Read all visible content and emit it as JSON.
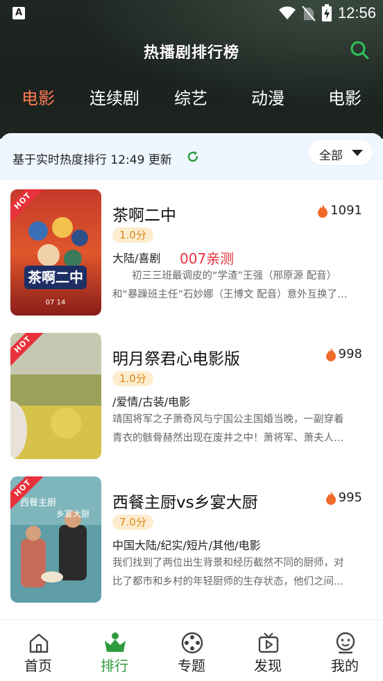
{
  "status": {
    "time": "12:56",
    "a_badge": "A"
  },
  "header": {
    "title": "热播剧排行榜"
  },
  "tabs": [
    "电影",
    "连续剧",
    "综艺",
    "动漫",
    "电影"
  ],
  "info": {
    "text": "基于实时热度排行 12:49 更新",
    "filter_label": "全部"
  },
  "items": [
    {
      "badge": "HOT",
      "title": "茶啊二中",
      "heat": "1091",
      "score": "1.0分",
      "genre": "大陆/喜剧",
      "tag": "007亲测",
      "desc1": "初三三班最调皮的“学渣”王强（邢原源 配音）",
      "desc2": "和“暴躁班主任”石妙娜（王博文 配音）意外互换了…"
    },
    {
      "badge": "HOT",
      "title": "明月祭君心电影版",
      "heat": "998",
      "score": "1.0分",
      "genre": "/爱情/古装/电影",
      "desc1": "靖国将军之子萧奇风与宁国公主国婚当晚，一副穿着",
      "desc2": "青衣的骸骨赫然出现在废井之中！萧将军、萧夫人…"
    },
    {
      "badge": "HOT",
      "title": "西餐主厨vs乡宴大厨",
      "heat": "995",
      "score": "7.0分",
      "genre": "中国大陆/纪实/短片/其他/电影",
      "desc1": "我们找到了两位出生背景和经历截然不同的厨师，对",
      "desc2": "比了都市和乡村的年轻厨师的生存状态，他们之间…"
    }
  ],
  "nav": [
    {
      "label": "首页",
      "icon": "home-icon"
    },
    {
      "label": "排行",
      "icon": "crown-icon"
    },
    {
      "label": "专题",
      "icon": "film-reel-icon"
    },
    {
      "label": "发现",
      "icon": "tv-play-icon"
    },
    {
      "label": "我的",
      "icon": "user-face-icon"
    }
  ],
  "colors": {
    "active_tab": "#ff7a55",
    "nav_active": "#2e9a3e",
    "hot": "#e8313b",
    "score_text": "#d88a17"
  }
}
